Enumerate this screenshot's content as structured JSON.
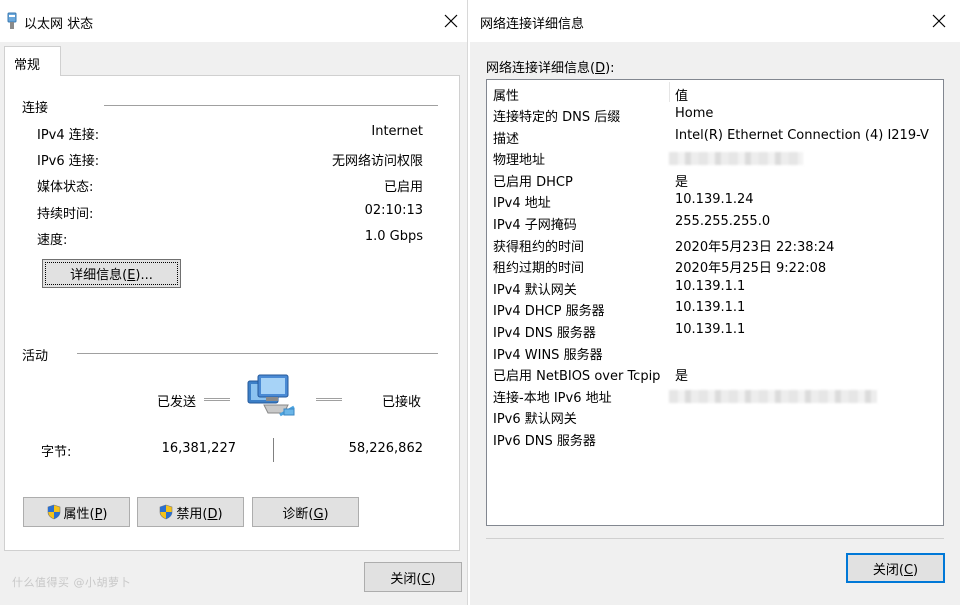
{
  "left": {
    "title": "以太网 状态",
    "tab": "常规",
    "connection": {
      "heading": "连接",
      "rows": [
        {
          "label": "IPv4 连接:",
          "value": "Internet"
        },
        {
          "label": "IPv6 连接:",
          "value": "无网络访问权限"
        },
        {
          "label": "媒体状态:",
          "value": "已启用"
        },
        {
          "label": "持续时间:",
          "value": "02:10:13"
        },
        {
          "label": "速度:",
          "value": "1.0 Gbps"
        }
      ],
      "details_button": {
        "text": "详细信息(",
        "key": "E",
        "tail": ")..."
      }
    },
    "activity": {
      "heading": "活动",
      "sent_label": "已发送",
      "received_label": "已接收",
      "bytes_label": "字节:",
      "bytes_sent": "16,381,227",
      "bytes_received": "58,226,862"
    },
    "buttons": {
      "properties": {
        "text": "属性(",
        "key": "P",
        "tail": ")"
      },
      "disable": {
        "text": "禁用(",
        "key": "D",
        "tail": ")"
      },
      "diagnose": {
        "text": "诊断(",
        "key": "G",
        "tail": ")"
      }
    },
    "close_button": {
      "text": "关闭(",
      "key": "C",
      "tail": ")"
    },
    "watermark": "什么值得买 @小胡萝卜"
  },
  "right": {
    "title": "网络连接详细信息",
    "caption": {
      "text": "网络连接详细信息(",
      "key": "D",
      "tail": "):"
    },
    "columns": {
      "property": "属性",
      "value": "值"
    },
    "rows": [
      {
        "property": "连接特定的 DNS 后缀",
        "value": "Home"
      },
      {
        "property": "描述",
        "value": "Intel(R) Ethernet Connection (4) I219-V"
      },
      {
        "property": "物理地址",
        "value": ""
      },
      {
        "property": "已启用 DHCP",
        "value": "是"
      },
      {
        "property": "IPv4 地址",
        "value": "10.139.1.24"
      },
      {
        "property": "IPv4 子网掩码",
        "value": "255.255.255.0"
      },
      {
        "property": "获得租约的时间",
        "value": "2020年5月23日 22:38:24"
      },
      {
        "property": "租约过期的时间",
        "value": "2020年5月25日 9:22:08"
      },
      {
        "property": "IPv4 默认网关",
        "value": "10.139.1.1"
      },
      {
        "property": "IPv4 DHCP 服务器",
        "value": "10.139.1.1"
      },
      {
        "property": "IPv4 DNS 服务器",
        "value": "10.139.1.1"
      },
      {
        "property": "IPv4 WINS 服务器",
        "value": ""
      },
      {
        "property": "已启用 NetBIOS over Tcpip",
        "value": "是"
      },
      {
        "property": "连接-本地 IPv6 地址",
        "value": ""
      },
      {
        "property": "IPv6 默认网关",
        "value": ""
      },
      {
        "property": "IPv6 DNS 服务器",
        "value": ""
      }
    ],
    "close_button": {
      "text": "关闭(",
      "key": "C",
      "tail": ")"
    }
  },
  "colors": {
    "accent": "#0078d7",
    "window_bg": "#f0f0f0",
    "panel_bg": "#ffffff"
  }
}
